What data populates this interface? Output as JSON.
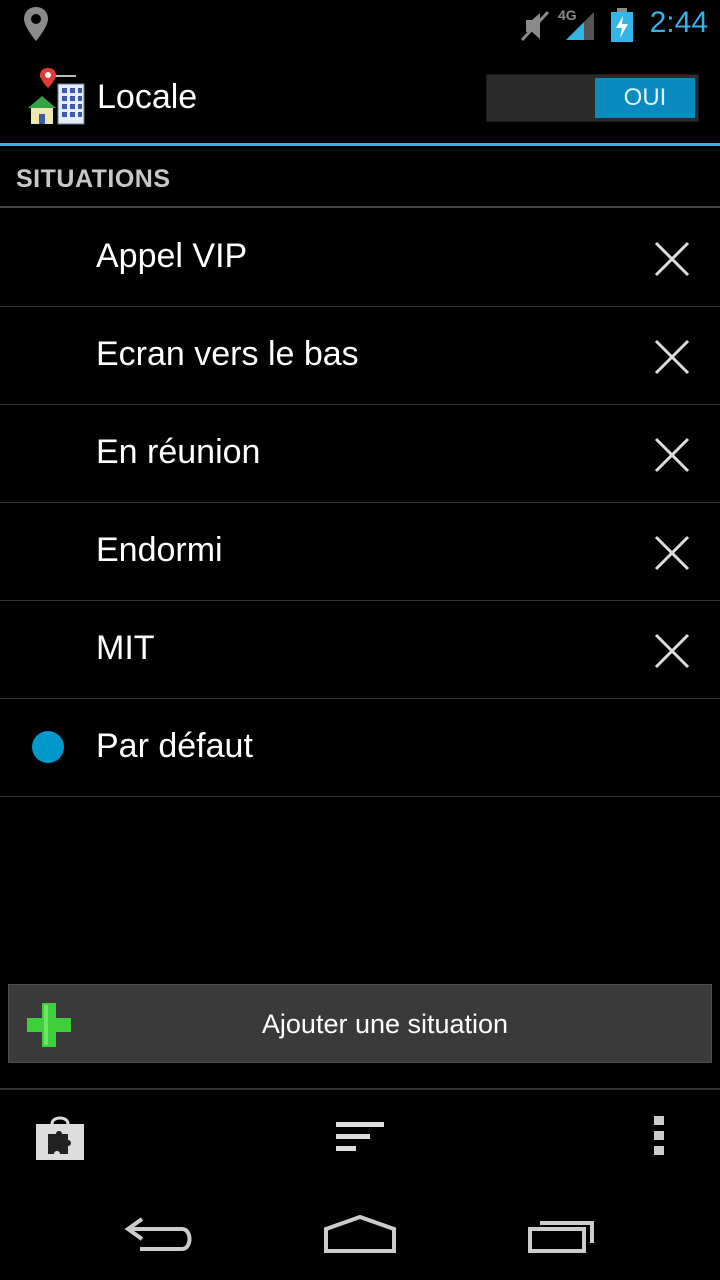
{
  "status": {
    "time": "2:44",
    "network": "4G",
    "icons": [
      "location-icon",
      "muted-icon",
      "signal-4g-icon",
      "battery-charging-icon"
    ]
  },
  "app": {
    "title": "Locale",
    "toggle_label": "OUI",
    "accent_color": "#33b5e5"
  },
  "section": {
    "title": "SITUATIONS"
  },
  "situations": [
    {
      "label": "Appel VIP",
      "deletable": true
    },
    {
      "label": "Ecran vers le bas",
      "deletable": true
    },
    {
      "label": "En réunion",
      "deletable": true
    },
    {
      "label": "Endormi",
      "deletable": true
    },
    {
      "label": "MIT",
      "deletable": true
    },
    {
      "label": "Par défaut",
      "deletable": false,
      "active": true
    }
  ],
  "add_button": {
    "label": "Ajouter une situation"
  },
  "bottom_actions": [
    "plugin-store-icon",
    "sort-icon",
    "overflow-menu-icon"
  ],
  "nav": [
    "back-icon",
    "home-icon",
    "recent-apps-icon"
  ]
}
